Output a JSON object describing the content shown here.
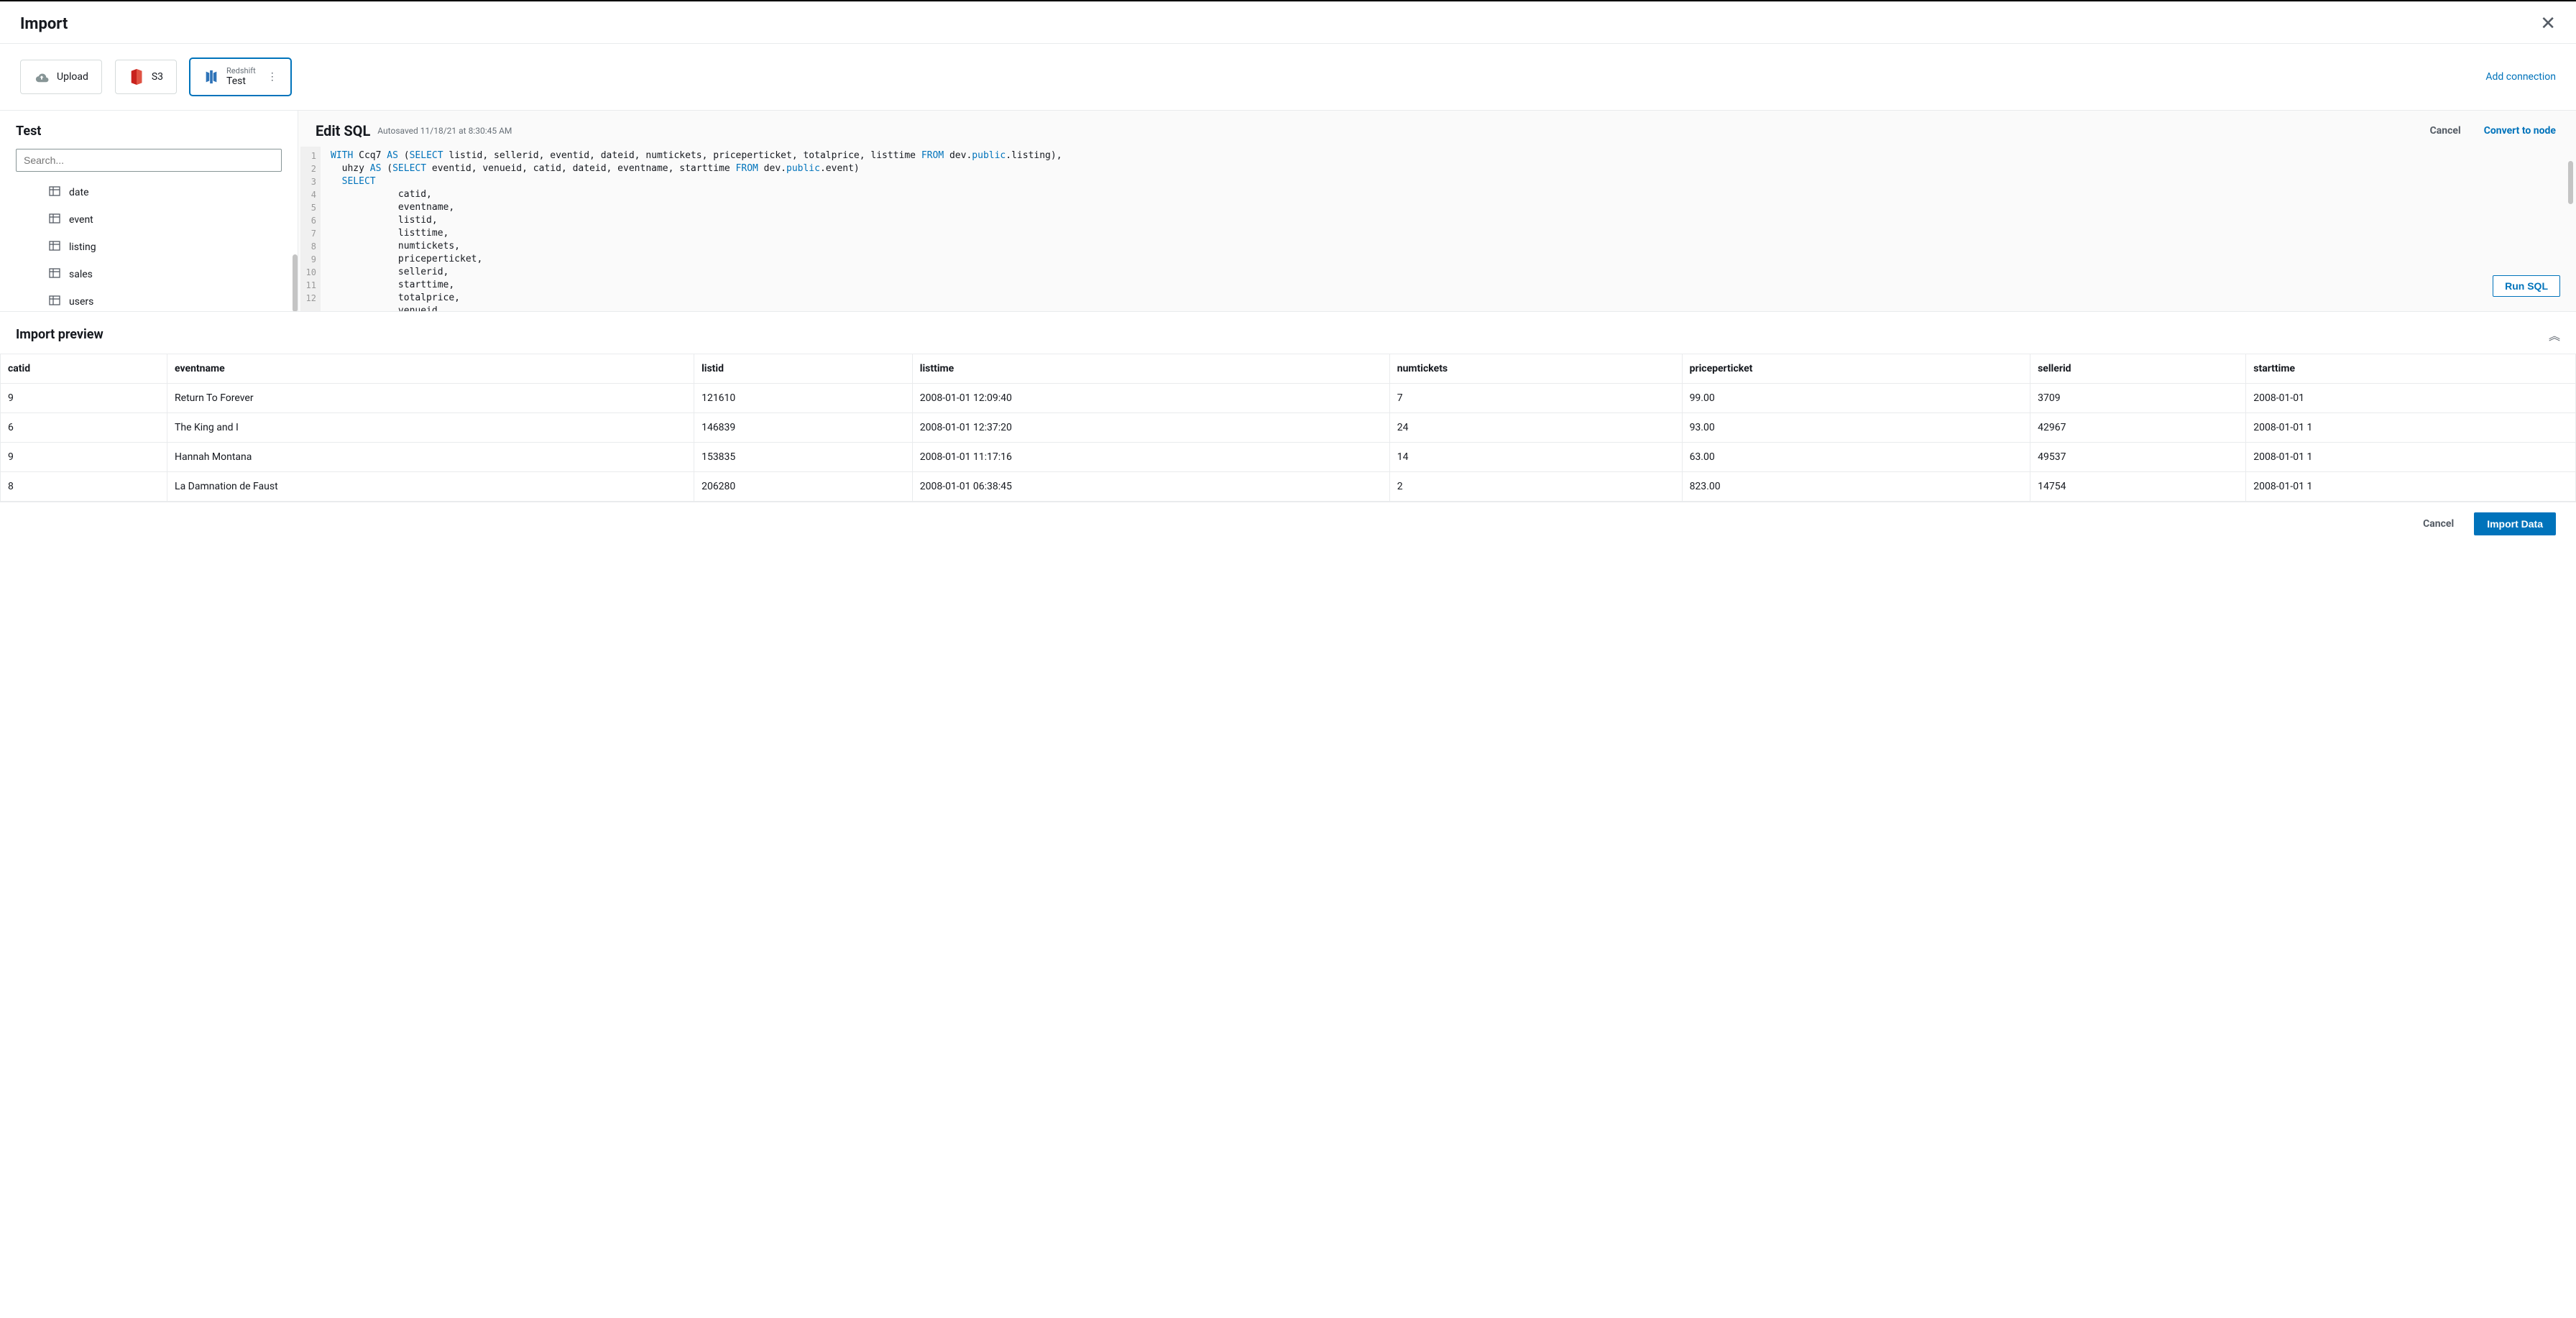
{
  "header": {
    "title": "Import"
  },
  "sources": {
    "upload": "Upload",
    "s3": "S3",
    "redshift_label": "Redshift",
    "redshift_name": "Test",
    "add_connection": "Add connection"
  },
  "sidebar": {
    "title": "Test",
    "search_placeholder": "Search...",
    "tables": [
      "date",
      "event",
      "listing",
      "sales",
      "users"
    ]
  },
  "editor": {
    "title": "Edit SQL",
    "autosaved": "Autosaved 11/18/21 at 8:30:45 AM",
    "cancel": "Cancel",
    "convert": "Convert to node",
    "run": "Run SQL",
    "line_numbers": [
      "1",
      "2",
      "3",
      "4",
      "5",
      "6",
      "7",
      "8",
      "9",
      "10",
      "11",
      "12"
    ],
    "code_html": "<span class='kw'>WITH</span> Ccq7 <span class='kw'>AS</span> (<span class='kw'>SELECT</span> listid, sellerid, eventid, dateid, numtickets, priceperticket, totalprice, listtime <span class='kw'>FROM</span> dev.<span class='sch'>public</span>.listing),\n  uhzy <span class='kw'>AS</span> (<span class='kw'>SELECT</span> eventid, venueid, catid, dateid, eventname, starttime <span class='kw'>FROM</span> dev.<span class='sch'>public</span>.event)\n  <span class='kw'>SELECT</span>\n            catid,\n            eventname,\n            listid,\n            listtime,\n            numtickets,\n            priceperticket,\n            sellerid,\n            starttime,\n            totalprice,\n            venueid,"
  },
  "preview": {
    "title": "Import preview",
    "columns": [
      "catid",
      "eventname",
      "listid",
      "listtime",
      "numtickets",
      "priceperticket",
      "sellerid",
      "starttime"
    ],
    "rows": [
      {
        "catid": "9",
        "eventname": "Return To Forever",
        "listid": "121610",
        "listtime": "2008-01-01 12:09:40",
        "numtickets": "7",
        "priceperticket": "99.00",
        "sellerid": "3709",
        "starttime": "2008-01-01"
      },
      {
        "catid": "6",
        "eventname": "The King and I",
        "listid": "146839",
        "listtime": "2008-01-01 12:37:20",
        "numtickets": "24",
        "priceperticket": "93.00",
        "sellerid": "42967",
        "starttime": "2008-01-01 1"
      },
      {
        "catid": "9",
        "eventname": "Hannah Montana",
        "listid": "153835",
        "listtime": "2008-01-01 11:17:16",
        "numtickets": "14",
        "priceperticket": "63.00",
        "sellerid": "49537",
        "starttime": "2008-01-01 1"
      },
      {
        "catid": "8",
        "eventname": "La Damnation de Faust",
        "listid": "206280",
        "listtime": "2008-01-01 06:38:45",
        "numtickets": "2",
        "priceperticket": "823.00",
        "sellerid": "14754",
        "starttime": "2008-01-01 1"
      }
    ]
  },
  "footer": {
    "cancel": "Cancel",
    "import": "Import Data"
  }
}
